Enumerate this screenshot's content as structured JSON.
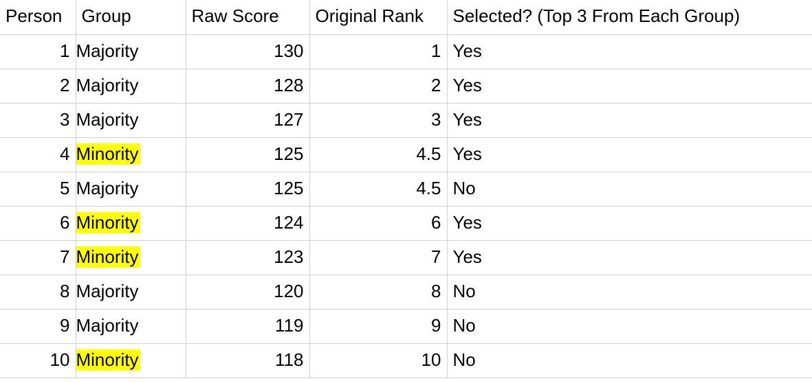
{
  "chart_data": {
    "type": "table",
    "title": "",
    "columns": [
      "Person",
      "Group",
      "Raw Score",
      "Original Rank",
      "Selected? (Top 3 From Each Group)"
    ],
    "highlight_group_value": "Minority",
    "rows": [
      {
        "person": 1,
        "group": "Majority",
        "raw_score": 130,
        "original_rank": "1",
        "selected": "Yes"
      },
      {
        "person": 2,
        "group": "Majority",
        "raw_score": 128,
        "original_rank": "2",
        "selected": "Yes"
      },
      {
        "person": 3,
        "group": "Majority",
        "raw_score": 127,
        "original_rank": "3",
        "selected": "Yes"
      },
      {
        "person": 4,
        "group": "Minority",
        "raw_score": 125,
        "original_rank": "4.5",
        "selected": "Yes"
      },
      {
        "person": 5,
        "group": "Majority",
        "raw_score": 125,
        "original_rank": "4.5",
        "selected": "No"
      },
      {
        "person": 6,
        "group": "Minority",
        "raw_score": 124,
        "original_rank": "6",
        "selected": "Yes"
      },
      {
        "person": 7,
        "group": "Minority",
        "raw_score": 123,
        "original_rank": "7",
        "selected": "Yes"
      },
      {
        "person": 8,
        "group": "Majority",
        "raw_score": 120,
        "original_rank": "8",
        "selected": "No"
      },
      {
        "person": 9,
        "group": "Majority",
        "raw_score": 119,
        "original_rank": "9",
        "selected": "No"
      },
      {
        "person": 10,
        "group": "Minority",
        "raw_score": 118,
        "original_rank": "10",
        "selected": "No"
      }
    ]
  }
}
